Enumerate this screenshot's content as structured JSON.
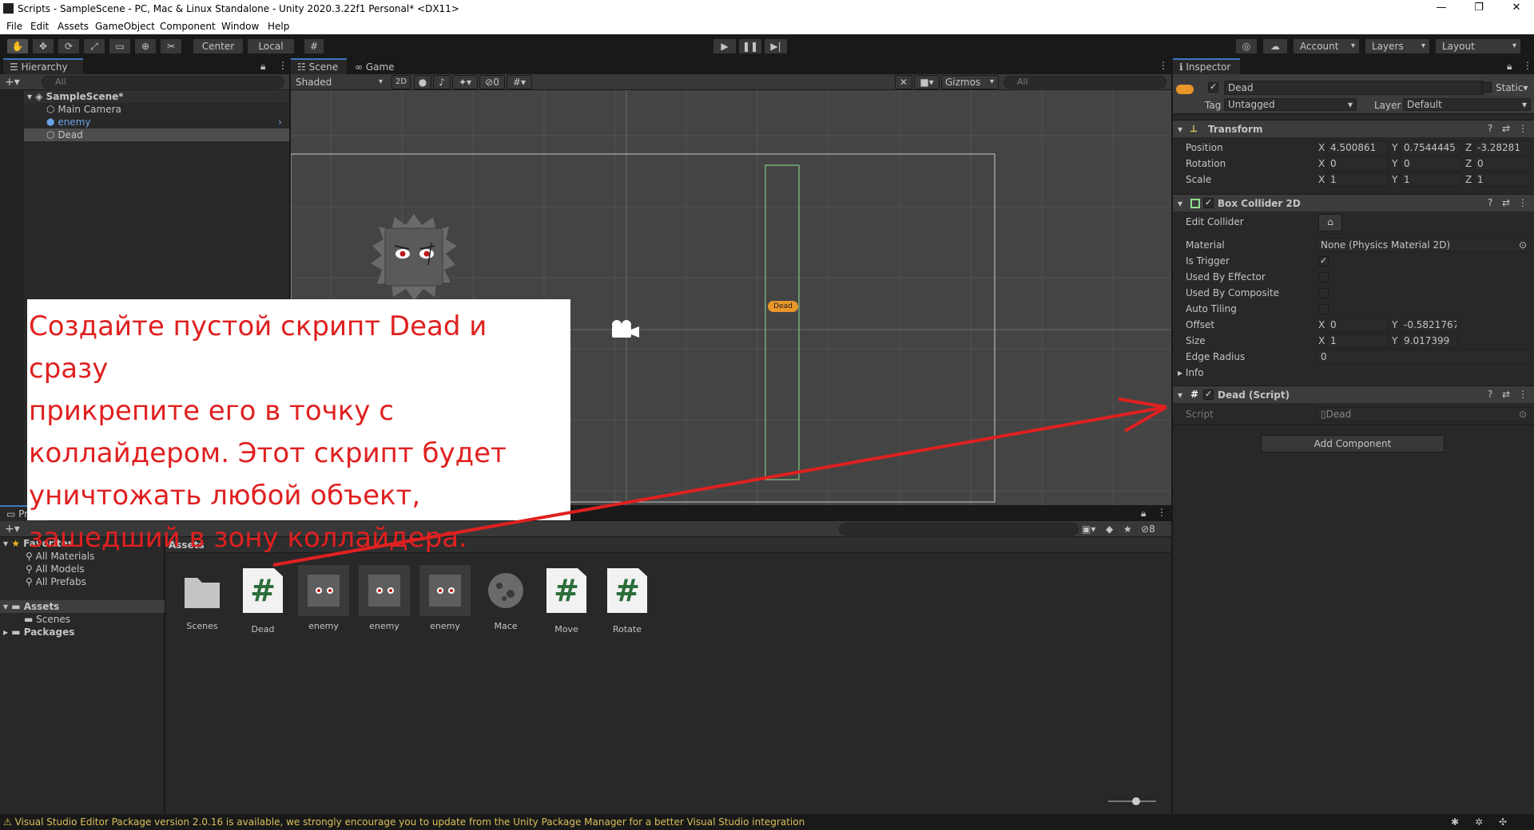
{
  "window": {
    "title": "Scripts - SampleScene - PC, Mac & Linux Standalone - Unity 2020.3.22f1 Personal* <DX11>"
  },
  "menu": [
    "File",
    "Edit",
    "Assets",
    "GameObject",
    "Component",
    "Window",
    "Help"
  ],
  "toolbar": {
    "center": "Center",
    "local": "Local",
    "account": "Account",
    "layers": "Layers",
    "layout": "Layout"
  },
  "hierarchy": {
    "tab": "Hierarchy",
    "search_placeholder": "All",
    "scene": "SampleScene*",
    "items": [
      {
        "label": "Main Camera"
      },
      {
        "label": "enemy"
      },
      {
        "label": "Dead"
      }
    ]
  },
  "scene_view": {
    "tabs": [
      "Scene",
      "Game"
    ],
    "shading": "Shaded",
    "mode2d": "2D",
    "hidden_count": "0",
    "gizmos": "Gizmos",
    "search_placeholder": "All",
    "object_label": "Dead"
  },
  "inspector": {
    "tab": "Inspector",
    "object_name": "Dead",
    "static_label": "Static",
    "tag_label": "Tag",
    "tag_value": "Untagged",
    "layer_label": "Layer",
    "layer_value": "Default",
    "transform": {
      "title": "Transform",
      "position": {
        "label": "Position",
        "x": "4.500861",
        "y": "0.7544445",
        "z": "-3.28281"
      },
      "rotation": {
        "label": "Rotation",
        "x": "0",
        "y": "0",
        "z": "0"
      },
      "scale": {
        "label": "Scale",
        "x": "1",
        "y": "1",
        "z": "1"
      }
    },
    "box_collider": {
      "title": "Box Collider 2D",
      "edit_collider": "Edit Collider",
      "material_label": "Material",
      "material_value": "None (Physics Material 2D)",
      "is_trigger": "Is Trigger",
      "used_by_effector": "Used By Effector",
      "used_by_composite": "Used By Composite",
      "auto_tiling": "Auto Tiling",
      "offset": {
        "label": "Offset",
        "x": "0",
        "y": "-0.5821767"
      },
      "size": {
        "label": "Size",
        "x": "1",
        "y": "9.017399"
      },
      "edge_radius": {
        "label": "Edge Radius",
        "value": "0"
      },
      "info": "Info"
    },
    "script_comp": {
      "title": "Dead (Script)",
      "script_label": "Script",
      "script_value": "Dead"
    },
    "add_component": "Add Component"
  },
  "project": {
    "tab": "Pr",
    "hidden_count": "8",
    "favorites": {
      "label": "Favorites",
      "items": [
        "All Materials",
        "All Models",
        "All Prefabs"
      ]
    },
    "assets_label": "Assets",
    "scenes_folder": "Scenes",
    "packages_label": "Packages",
    "breadcrumb": "Assets",
    "assets": [
      {
        "name": "Scenes",
        "kind": "folder"
      },
      {
        "name": "Dead",
        "kind": "script"
      },
      {
        "name": "enemy",
        "kind": "sprite"
      },
      {
        "name": "enemy",
        "kind": "sprite"
      },
      {
        "name": "enemy",
        "kind": "sprite"
      },
      {
        "name": "Mace",
        "kind": "sprite"
      },
      {
        "name": "Move",
        "kind": "script"
      },
      {
        "name": "Rotate",
        "kind": "script"
      }
    ]
  },
  "annotation": {
    "lines": [
      "Создайте пустой скрипт Dead и сразу",
      "прикрепите его в точку с",
      "коллайдером. Этот скрипт будет",
      "уничтожать любой объект,",
      "зашедший в зону коллайдера."
    ],
    "color": "#e02020"
  },
  "status": {
    "message": "Visual Studio Editor Package version 2.0.16 is available, we strongly encourage you to update from the Unity Package Manager for a better Visual Studio integration"
  },
  "colors": {
    "accent": "#3a79bb",
    "panel": "#282828",
    "warning": "#d8c05a"
  }
}
